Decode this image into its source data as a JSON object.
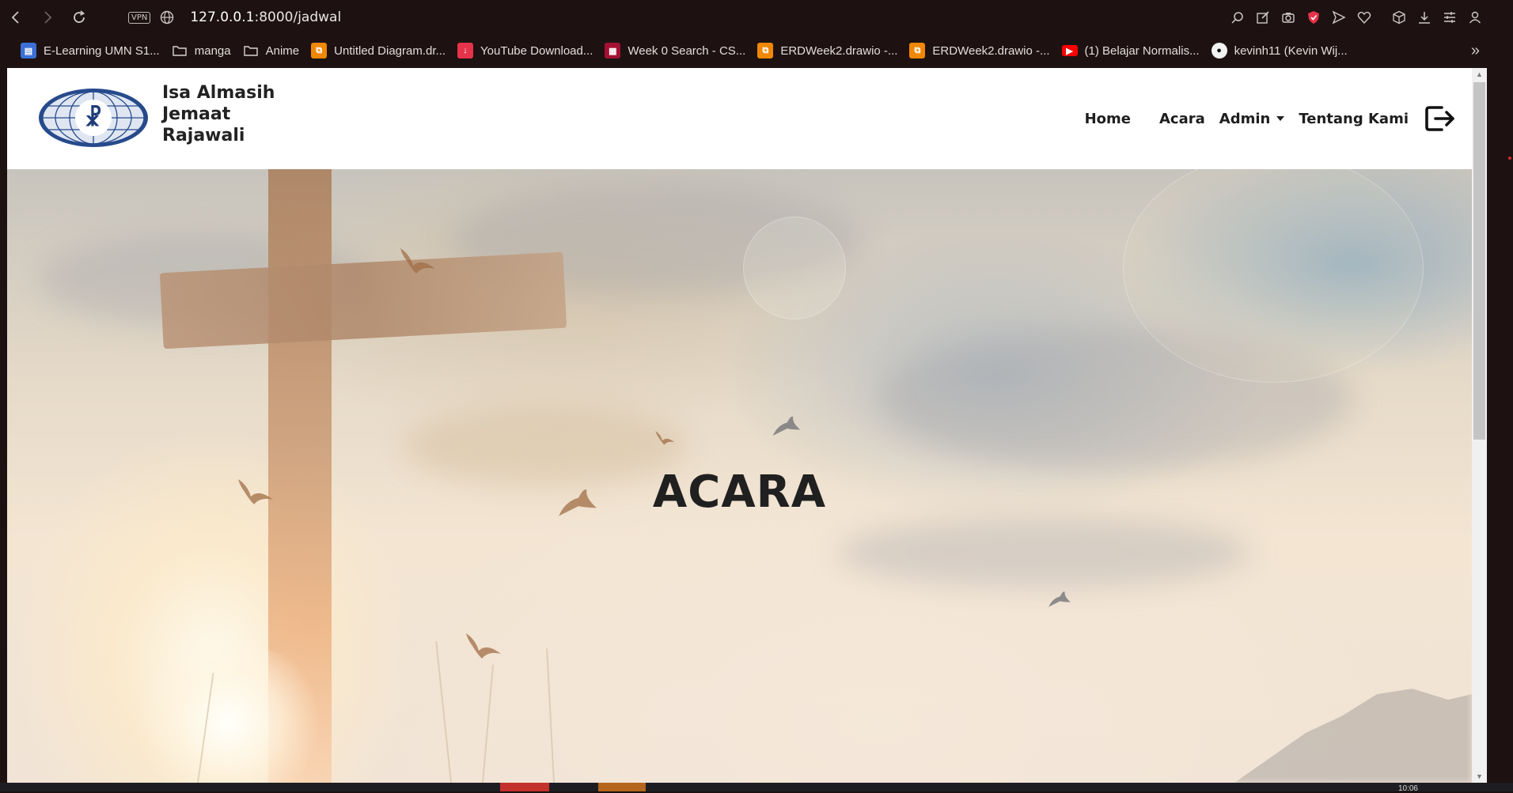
{
  "browser": {
    "url_host": "127.0.0.1",
    "url_path": ":8000/jadwal",
    "vpn_label": "VPN",
    "nav_icons": [
      "back-icon",
      "forward-icon",
      "reload-icon"
    ],
    "toolbar_icons": [
      "search-icon",
      "edit-icon",
      "camera-icon",
      "shield-icon",
      "send-icon",
      "heart-icon",
      "cube-icon",
      "download-icon",
      "menu-icon",
      "profile-icon"
    ]
  },
  "bookmarks": [
    {
      "label": "E-Learning UMN S1...",
      "color": "#3b6fd6"
    },
    {
      "label": "manga",
      "color": "folder"
    },
    {
      "label": "Anime",
      "color": "folder"
    },
    {
      "label": "Untitled Diagram.dr...",
      "color": "#f08705"
    },
    {
      "label": "YouTube Download...",
      "color": "#e5334a"
    },
    {
      "label": "Week 0 Search - CS...",
      "color": "#a41034"
    },
    {
      "label": "ERDWeek2.drawio -...",
      "color": "#f08705"
    },
    {
      "label": "ERDWeek2.drawio -...",
      "color": "#f08705"
    },
    {
      "label": "(1) Belajar Normalis...",
      "color": "#ff0000"
    },
    {
      "label": "kevinh11 (Kevin Wij...",
      "color": "github"
    }
  ],
  "site": {
    "brand_line1": "Isa Almasih",
    "brand_line2": "Jemaat",
    "brand_line3": "Rajawali",
    "nav": {
      "home": "Home",
      "acara": "Acara",
      "admin": "Admin",
      "tentang": "Tentang Kami"
    },
    "hero_title": "ACARA"
  },
  "taskbar": {
    "clock": "10:06"
  }
}
